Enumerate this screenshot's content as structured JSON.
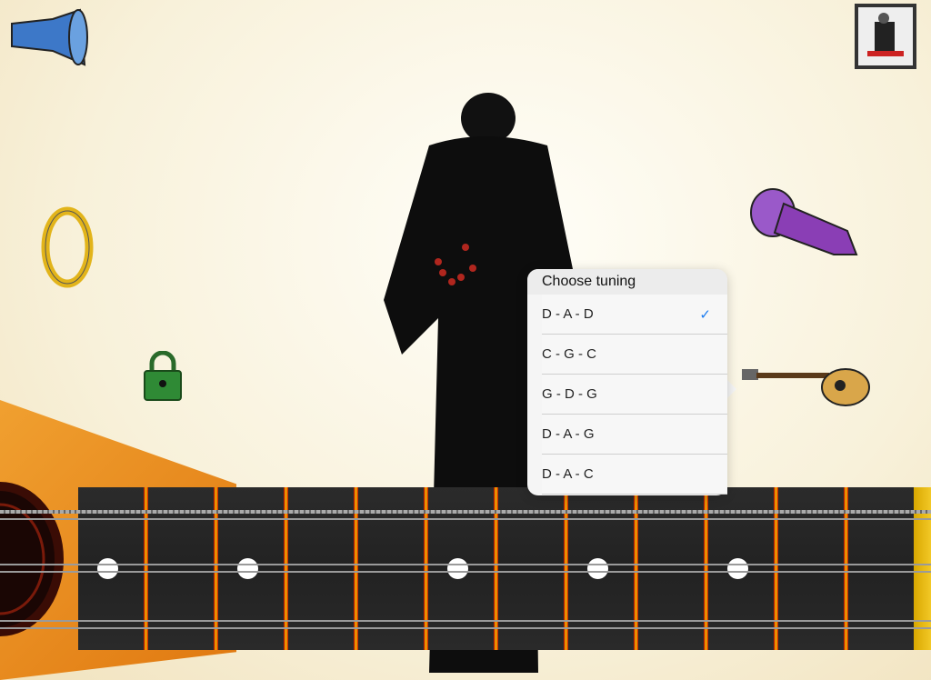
{
  "tuning_menu": {
    "title": "Choose tuning",
    "options": [
      {
        "label": "D - A - D",
        "selected": true
      },
      {
        "label": "C - G - C",
        "selected": false
      },
      {
        "label": "G - D - G",
        "selected": false
      },
      {
        "label": "D - A - G",
        "selected": false
      },
      {
        "label": "D - A - C",
        "selected": false
      }
    ],
    "check_icon": "✓"
  },
  "colors": {
    "accent": "#1a7bf0",
    "body": "#e88a1c",
    "fret": "#d01000"
  }
}
